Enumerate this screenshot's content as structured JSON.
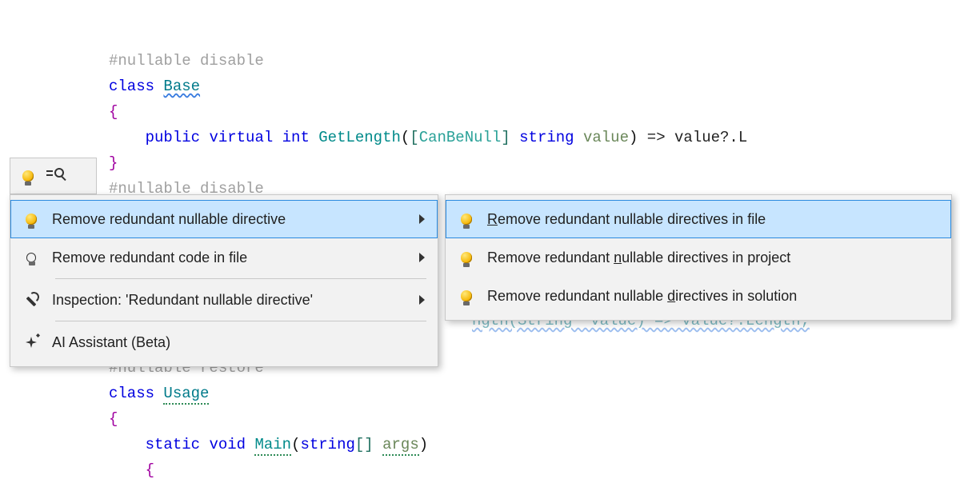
{
  "code": {
    "line1_directive": "#nullable disable",
    "line2_class_kw": "class ",
    "line2_class_name": "Base",
    "line3_brace_open": "{",
    "line4_indent": "    ",
    "line4_public": "public ",
    "line4_virtual": "virtual ",
    "line4_int": "int ",
    "line4_method": "GetLength",
    "line4_paren_open": "(",
    "line4_bracket_open": "[",
    "line4_attr": "CanBeNull",
    "line4_bracket_close": "] ",
    "line4_string": "string ",
    "line4_param": "value",
    "line4_paren_close": ") ",
    "line4_arrow": "=> ",
    "line4_expr": "value?.L",
    "line5_brace_close": "}",
    "line6_directive": "#nullable disable",
    "line13_directive": "#nullable restore",
    "line14_class_kw": "class ",
    "line14_class_name": "Usage",
    "line15_brace_open": "{",
    "line16_indent": "    ",
    "line16_static": "static ",
    "line16_void": "void ",
    "line16_main": "Main",
    "line16_paren_open": "(",
    "line16_string": "string",
    "line16_brackets": "[] ",
    "line16_args": "args",
    "line16_paren_close": ")",
    "line17_brace_open": "    {"
  },
  "leak": "ngth(String  value) => value?.Length;",
  "menu": {
    "items": [
      {
        "label": "Remove redundant nullable directive",
        "icon": "lightbulb",
        "has_submenu": true,
        "selected": true
      },
      {
        "label": "Remove redundant code in file",
        "icon": "lightbulb-outline",
        "has_submenu": true
      },
      {
        "label": "Inspection: 'Redundant nullable directive'",
        "icon": "wrench",
        "has_submenu": true
      },
      {
        "label": "AI Assistant (Beta)",
        "icon": "sparkle",
        "has_submenu": false
      }
    ]
  },
  "submenu": {
    "items": [
      {
        "pre": "",
        "u": "R",
        "post": "emove redundant nullable directives in file",
        "selected": true
      },
      {
        "pre": "Remove redundant ",
        "u": "n",
        "post": "ullable directives in project"
      },
      {
        "pre": "Remove redundant nullable ",
        "u": "d",
        "post": "irectives in solution"
      }
    ]
  },
  "colors": {
    "menu_bg": "#f2f2f2",
    "menu_border": "#c8c8c8",
    "selected_bg": "#c7e5ff",
    "selected_border": "#2a8adf"
  }
}
